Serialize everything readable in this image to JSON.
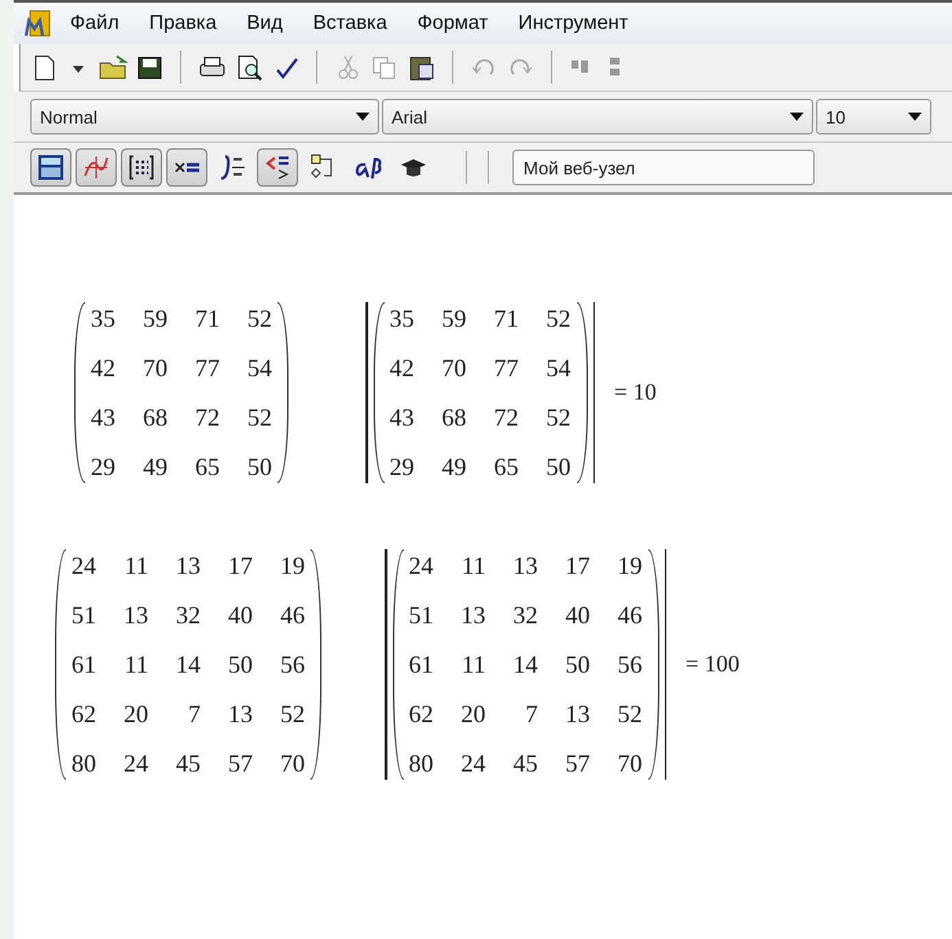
{
  "menu": [
    "Файл",
    "Правка",
    "Вид",
    "Вставка",
    "Формат",
    "Инструмент"
  ],
  "format_bar": {
    "style": "Normal",
    "font": "Arial",
    "size": "10"
  },
  "math_toolbar": [
    {
      "on": true
    },
    {
      "on": true
    },
    {
      "on": true
    },
    {
      "on": true
    },
    {
      "on": false
    },
    {
      "on": true
    },
    {
      "on": false
    },
    {
      "on": false
    },
    {
      "on": false
    }
  ],
  "web_field": {
    "value": "Мой веб-узел"
  },
  "worksheet": [
    {
      "matrix": [
        [
          "35",
          "59",
          "71",
          "52"
        ],
        [
          "42",
          "70",
          "77",
          "54"
        ],
        [
          "43",
          "68",
          "72",
          "52"
        ],
        [
          "29",
          "49",
          "65",
          "50"
        ]
      ],
      "determinant": {
        "matrix": [
          [
            "35",
            "59",
            "71",
            "52"
          ],
          [
            "42",
            "70",
            "77",
            "54"
          ],
          [
            "43",
            "68",
            "72",
            "52"
          ],
          [
            "29",
            "49",
            "65",
            "50"
          ]
        ],
        "result": "= 10"
      }
    },
    {
      "matrix": [
        [
          "24",
          "11",
          "13",
          "17",
          "19"
        ],
        [
          "51",
          "13",
          "32",
          "40",
          "46"
        ],
        [
          "61",
          "11",
          "14",
          "50",
          "56"
        ],
        [
          "62",
          "20",
          "7",
          "13",
          "52"
        ],
        [
          "80",
          "24",
          "45",
          "57",
          "70"
        ]
      ],
      "determinant": {
        "matrix": [
          [
            "24",
            "11",
            "13",
            "17",
            "19"
          ],
          [
            "51",
            "13",
            "32",
            "40",
            "46"
          ],
          [
            "61",
            "11",
            "14",
            "50",
            "56"
          ],
          [
            "62",
            "20",
            "7",
            "13",
            "52"
          ],
          [
            "80",
            "24",
            "45",
            "57",
            "70"
          ]
        ],
        "result": "= 100"
      }
    }
  ]
}
